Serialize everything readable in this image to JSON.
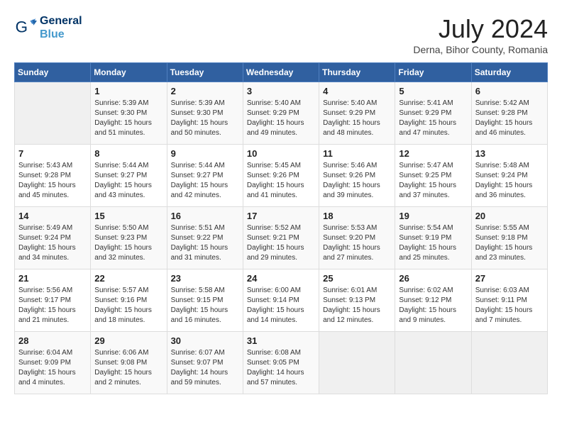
{
  "header": {
    "logo_line1": "General",
    "logo_line2": "Blue",
    "month_year": "July 2024",
    "location": "Derna, Bihor County, Romania"
  },
  "weekdays": [
    "Sunday",
    "Monday",
    "Tuesday",
    "Wednesday",
    "Thursday",
    "Friday",
    "Saturday"
  ],
  "weeks": [
    [
      {
        "day": "",
        "info": ""
      },
      {
        "day": "1",
        "info": "Sunrise: 5:39 AM\nSunset: 9:30 PM\nDaylight: 15 hours\nand 51 minutes."
      },
      {
        "day": "2",
        "info": "Sunrise: 5:39 AM\nSunset: 9:30 PM\nDaylight: 15 hours\nand 50 minutes."
      },
      {
        "day": "3",
        "info": "Sunrise: 5:40 AM\nSunset: 9:29 PM\nDaylight: 15 hours\nand 49 minutes."
      },
      {
        "day": "4",
        "info": "Sunrise: 5:40 AM\nSunset: 9:29 PM\nDaylight: 15 hours\nand 48 minutes."
      },
      {
        "day": "5",
        "info": "Sunrise: 5:41 AM\nSunset: 9:29 PM\nDaylight: 15 hours\nand 47 minutes."
      },
      {
        "day": "6",
        "info": "Sunrise: 5:42 AM\nSunset: 9:28 PM\nDaylight: 15 hours\nand 46 minutes."
      }
    ],
    [
      {
        "day": "7",
        "info": "Sunrise: 5:43 AM\nSunset: 9:28 PM\nDaylight: 15 hours\nand 45 minutes."
      },
      {
        "day": "8",
        "info": "Sunrise: 5:44 AM\nSunset: 9:27 PM\nDaylight: 15 hours\nand 43 minutes."
      },
      {
        "day": "9",
        "info": "Sunrise: 5:44 AM\nSunset: 9:27 PM\nDaylight: 15 hours\nand 42 minutes."
      },
      {
        "day": "10",
        "info": "Sunrise: 5:45 AM\nSunset: 9:26 PM\nDaylight: 15 hours\nand 41 minutes."
      },
      {
        "day": "11",
        "info": "Sunrise: 5:46 AM\nSunset: 9:26 PM\nDaylight: 15 hours\nand 39 minutes."
      },
      {
        "day": "12",
        "info": "Sunrise: 5:47 AM\nSunset: 9:25 PM\nDaylight: 15 hours\nand 37 minutes."
      },
      {
        "day": "13",
        "info": "Sunrise: 5:48 AM\nSunset: 9:24 PM\nDaylight: 15 hours\nand 36 minutes."
      }
    ],
    [
      {
        "day": "14",
        "info": "Sunrise: 5:49 AM\nSunset: 9:24 PM\nDaylight: 15 hours\nand 34 minutes."
      },
      {
        "day": "15",
        "info": "Sunrise: 5:50 AM\nSunset: 9:23 PM\nDaylight: 15 hours\nand 32 minutes."
      },
      {
        "day": "16",
        "info": "Sunrise: 5:51 AM\nSunset: 9:22 PM\nDaylight: 15 hours\nand 31 minutes."
      },
      {
        "day": "17",
        "info": "Sunrise: 5:52 AM\nSunset: 9:21 PM\nDaylight: 15 hours\nand 29 minutes."
      },
      {
        "day": "18",
        "info": "Sunrise: 5:53 AM\nSunset: 9:20 PM\nDaylight: 15 hours\nand 27 minutes."
      },
      {
        "day": "19",
        "info": "Sunrise: 5:54 AM\nSunset: 9:19 PM\nDaylight: 15 hours\nand 25 minutes."
      },
      {
        "day": "20",
        "info": "Sunrise: 5:55 AM\nSunset: 9:18 PM\nDaylight: 15 hours\nand 23 minutes."
      }
    ],
    [
      {
        "day": "21",
        "info": "Sunrise: 5:56 AM\nSunset: 9:17 PM\nDaylight: 15 hours\nand 21 minutes."
      },
      {
        "day": "22",
        "info": "Sunrise: 5:57 AM\nSunset: 9:16 PM\nDaylight: 15 hours\nand 18 minutes."
      },
      {
        "day": "23",
        "info": "Sunrise: 5:58 AM\nSunset: 9:15 PM\nDaylight: 15 hours\nand 16 minutes."
      },
      {
        "day": "24",
        "info": "Sunrise: 6:00 AM\nSunset: 9:14 PM\nDaylight: 15 hours\nand 14 minutes."
      },
      {
        "day": "25",
        "info": "Sunrise: 6:01 AM\nSunset: 9:13 PM\nDaylight: 15 hours\nand 12 minutes."
      },
      {
        "day": "26",
        "info": "Sunrise: 6:02 AM\nSunset: 9:12 PM\nDaylight: 15 hours\nand 9 minutes."
      },
      {
        "day": "27",
        "info": "Sunrise: 6:03 AM\nSunset: 9:11 PM\nDaylight: 15 hours\nand 7 minutes."
      }
    ],
    [
      {
        "day": "28",
        "info": "Sunrise: 6:04 AM\nSunset: 9:09 PM\nDaylight: 15 hours\nand 4 minutes."
      },
      {
        "day": "29",
        "info": "Sunrise: 6:06 AM\nSunset: 9:08 PM\nDaylight: 15 hours\nand 2 minutes."
      },
      {
        "day": "30",
        "info": "Sunrise: 6:07 AM\nSunset: 9:07 PM\nDaylight: 14 hours\nand 59 minutes."
      },
      {
        "day": "31",
        "info": "Sunrise: 6:08 AM\nSunset: 9:05 PM\nDaylight: 14 hours\nand 57 minutes."
      },
      {
        "day": "",
        "info": ""
      },
      {
        "day": "",
        "info": ""
      },
      {
        "day": "",
        "info": ""
      }
    ]
  ]
}
